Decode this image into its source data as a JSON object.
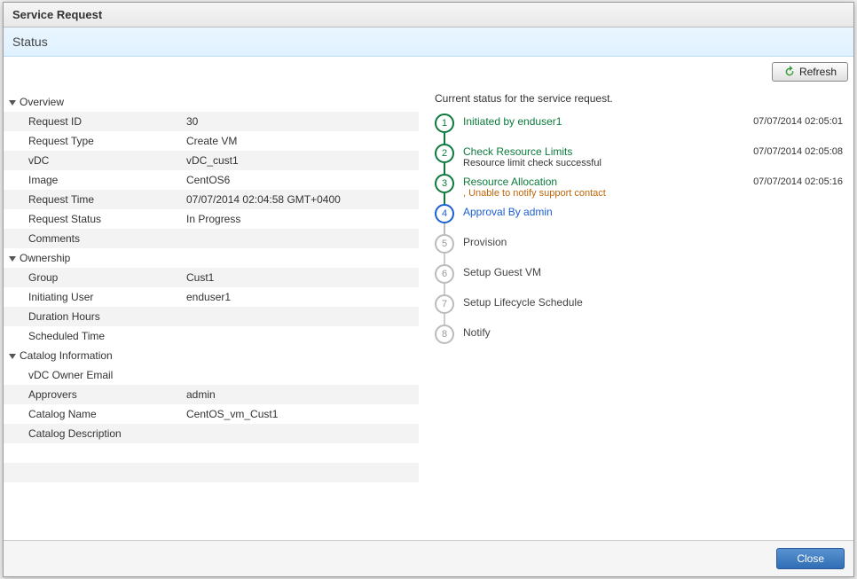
{
  "dialog": {
    "title": "Service Request",
    "status_tab": "Status",
    "refresh_label": "Refresh",
    "close_label": "Close"
  },
  "overview": {
    "section_label": "Overview",
    "fields": {
      "request_id_label": "Request ID",
      "request_id_value": "30",
      "request_type_label": "Request Type",
      "request_type_value": "Create VM",
      "vdc_label": "vDC",
      "vdc_value": "vDC_cust1",
      "image_label": "Image",
      "image_value": "CentOS6",
      "request_time_label": "Request Time",
      "request_time_value": "07/07/2014 02:04:58 GMT+0400",
      "request_status_label": "Request Status",
      "request_status_value": "In Progress",
      "comments_label": "Comments",
      "comments_value": ""
    }
  },
  "ownership": {
    "section_label": "Ownership",
    "fields": {
      "group_label": "Group",
      "group_value": "Cust1",
      "initiating_user_label": "Initiating User",
      "initiating_user_value": "enduser1",
      "duration_hours_label": "Duration Hours",
      "duration_hours_value": "",
      "scheduled_time_label": "Scheduled Time",
      "scheduled_time_value": ""
    }
  },
  "catalog": {
    "section_label": "Catalog Information",
    "fields": {
      "vdc_owner_email_label": "vDC Owner Email",
      "vdc_owner_email_value": "",
      "approvers_label": "Approvers",
      "approvers_value": "admin",
      "catalog_name_label": "Catalog Name",
      "catalog_name_value": "CentOS_vm_Cust1",
      "catalog_desc_label": "Catalog Description",
      "catalog_desc_value": ""
    }
  },
  "workflow": {
    "heading": "Current status for the service request.",
    "steps": [
      {
        "num": "1",
        "title": "Initiated by enduser1",
        "sub": "",
        "sub_warn": false,
        "time": "07/07/2014 02:05:01",
        "state": "done"
      },
      {
        "num": "2",
        "title": "Check Resource Limits",
        "sub": "Resource limit check successful",
        "sub_warn": false,
        "time": "07/07/2014 02:05:08",
        "state": "done"
      },
      {
        "num": "3",
        "title": "Resource Allocation",
        "sub": ", Unable to notify support contact",
        "sub_warn": true,
        "time": "07/07/2014 02:05:16",
        "state": "done"
      },
      {
        "num": "4",
        "title": "Approval By admin",
        "sub": "",
        "sub_warn": false,
        "time": "",
        "state": "current"
      },
      {
        "num": "5",
        "title": "Provision",
        "sub": "",
        "sub_warn": false,
        "time": "",
        "state": "pending"
      },
      {
        "num": "6",
        "title": "Setup Guest VM",
        "sub": "",
        "sub_warn": false,
        "time": "",
        "state": "pending"
      },
      {
        "num": "7",
        "title": "Setup Lifecycle Schedule",
        "sub": "",
        "sub_warn": false,
        "time": "",
        "state": "pending"
      },
      {
        "num": "8",
        "title": "Notify",
        "sub": "",
        "sub_warn": false,
        "time": "",
        "state": "pending"
      }
    ]
  }
}
